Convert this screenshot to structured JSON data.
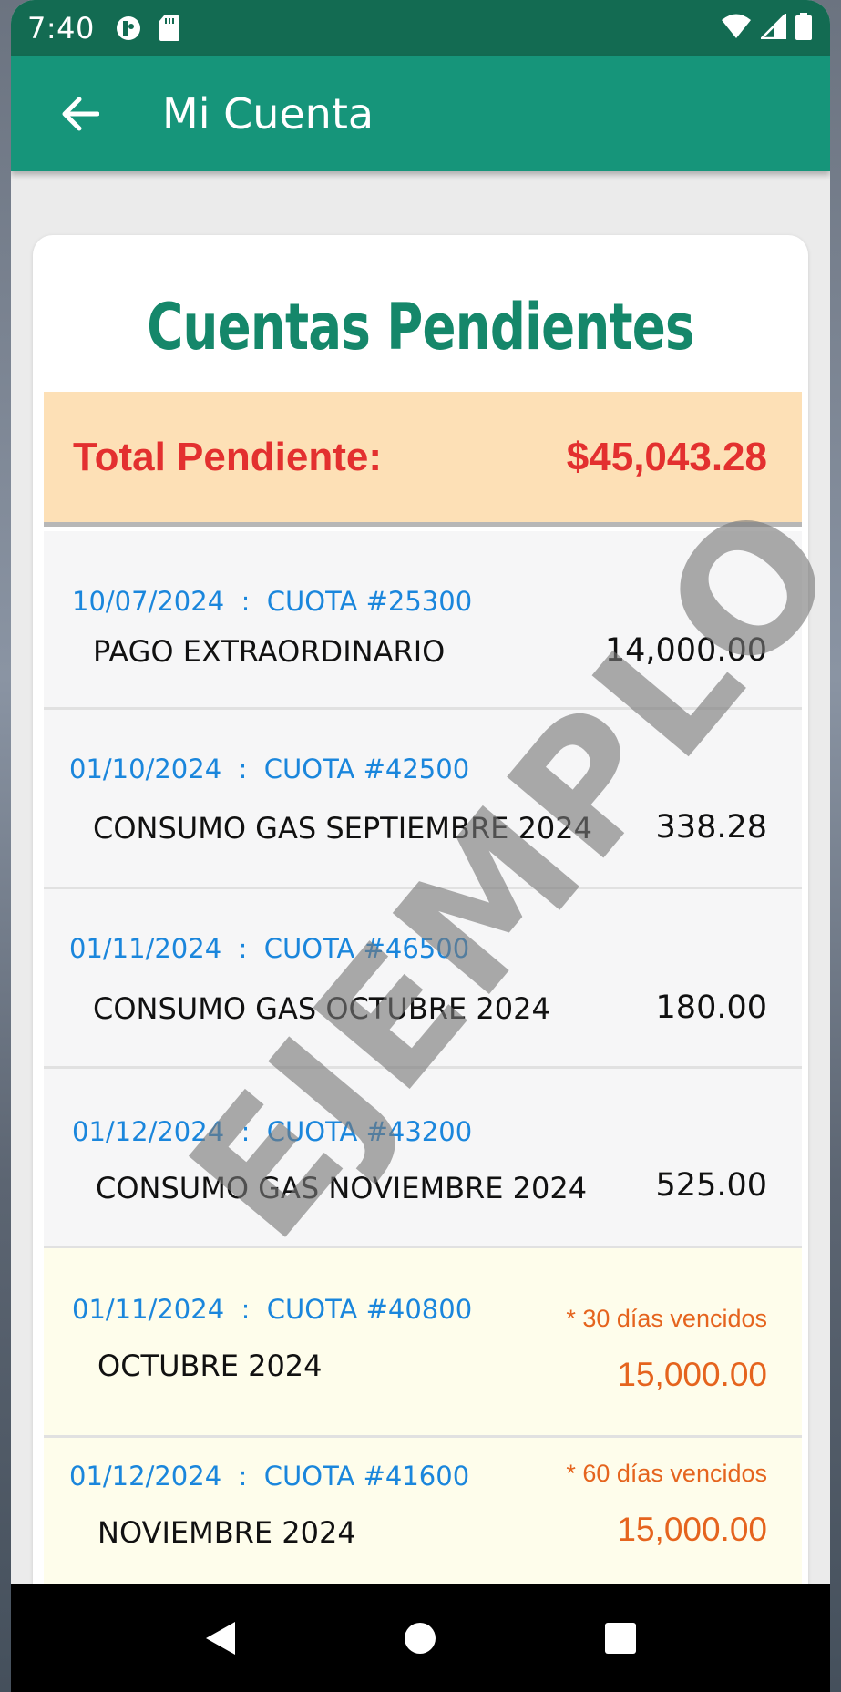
{
  "status_bar": {
    "time": "7:40",
    "icons": [
      "app-notification-icon",
      "sd-card-icon",
      "wifi-icon",
      "signal-icon",
      "battery-icon"
    ]
  },
  "app_bar": {
    "title": "Mi Cuenta",
    "back_icon": "arrow-back-icon"
  },
  "card": {
    "title": "Cuentas Pendientes",
    "total_label": "Total Pendiente:",
    "total_value": "$45,043.28"
  },
  "items": [
    {
      "meta": "10/07/2024  :  CUOTA #25300",
      "description": "PAGO EXTRAORDINARIO",
      "amount": "14,000.00",
      "overdue_note": ""
    },
    {
      "meta": "01/10/2024  :  CUOTA #42500",
      "description": "CONSUMO GAS SEPTIEMBRE 2024",
      "amount": "338.28",
      "overdue_note": ""
    },
    {
      "meta": "01/11/2024  :  CUOTA #46500",
      "description": "CONSUMO GAS OCTUBRE 2024",
      "amount": "180.00",
      "overdue_note": ""
    },
    {
      "meta": "01/12/2024  :  CUOTA #43200",
      "description": "CONSUMO GAS NOVIEMBRE 2024",
      "amount": "525.00",
      "overdue_note": ""
    },
    {
      "meta": "01/11/2024  :  CUOTA #40800",
      "description": "OCTUBRE 2024",
      "amount": "15,000.00",
      "overdue_note": "* 30 días vencidos"
    },
    {
      "meta": "01/12/2024  :  CUOTA #41600",
      "description": "NOVIEMBRE 2024",
      "amount": "15,000.00",
      "overdue_note": "* 60 días vencidos"
    }
  ],
  "watermark": "EJEMPLO",
  "colors": {
    "status_bar": "#136b52",
    "app_bar": "#16957a",
    "title_green": "#15876a",
    "total_bg": "#fde0b6",
    "total_red": "#e3302f",
    "meta_blue": "#1a86dc",
    "overdue_orange": "#e5641e",
    "overdue_bg": "#fefdeb"
  },
  "nav_bar": {
    "icons": [
      "nav-back-icon",
      "nav-home-icon",
      "nav-recents-icon"
    ]
  }
}
